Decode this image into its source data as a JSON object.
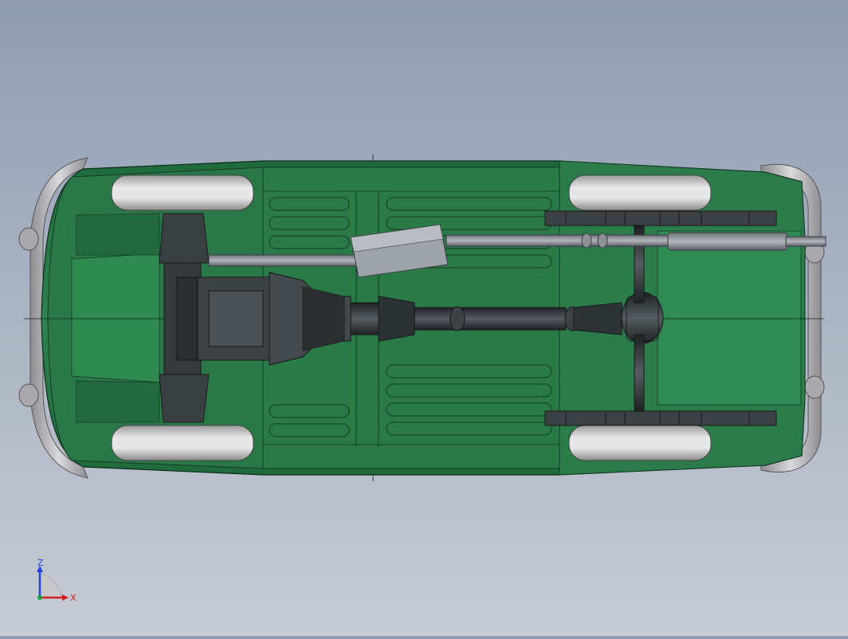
{
  "viewport": {
    "background_top": "#8f9db2",
    "background_bottom": "#c7cbd4"
  },
  "model": {
    "body_color": "#2e7d4f",
    "body_dark": "#1f5e3a",
    "tire_color": "#cfcfcf",
    "drivetrain_color": "#3a3f42",
    "exhaust_color": "#8a8e96",
    "bumper_color": "#b8b8bc"
  },
  "triad": {
    "z_label": "Z",
    "x_label": "X",
    "z_color": "#2040e0",
    "x_color": "#d02020"
  }
}
